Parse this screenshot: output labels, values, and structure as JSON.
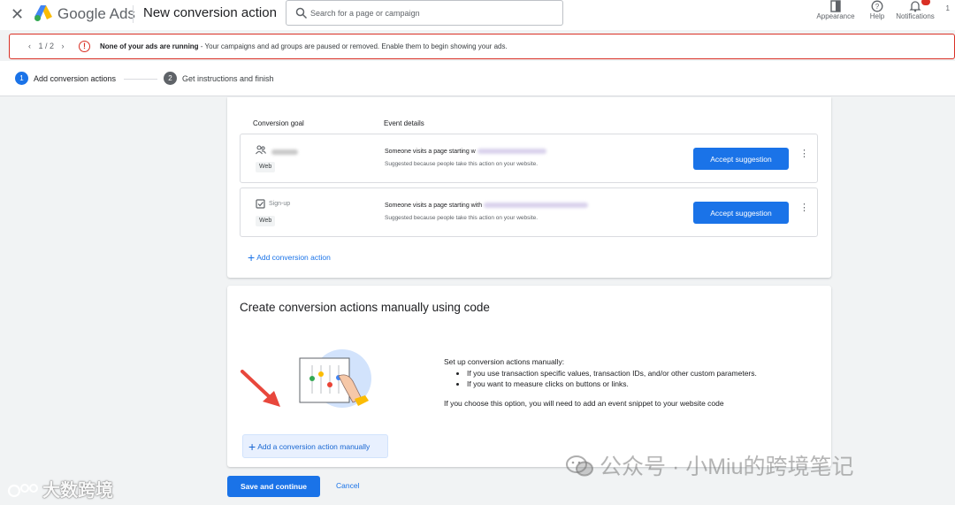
{
  "header": {
    "brand": "Google Ads",
    "title": "New conversion action",
    "search_placeholder": "Search for a page or campaign",
    "actions": [
      {
        "label": "Appearance",
        "icon": "appearance-icon"
      },
      {
        "label": "Help",
        "icon": "help-icon"
      },
      {
        "label": "Notifications",
        "icon": "bell-icon"
      }
    ],
    "edge_char": "1"
  },
  "alert": {
    "pager": "1 / 2",
    "title": "None of your ads are running",
    "message": " - Your campaigns and ad groups are paused or removed. Enable them to begin showing your ads."
  },
  "stepper": {
    "steps": [
      {
        "num": "1",
        "label": "Add conversion actions",
        "active": true
      },
      {
        "num": "2",
        "label": "Get instructions and finish",
        "active": false
      }
    ]
  },
  "suggestions": {
    "col_goal": "Conversion goal",
    "col_event": "Event details",
    "rows": [
      {
        "goal_type": "Web",
        "event_prefix": "Someone visits a page starting w",
        "event_reason": "Suggested because people take this action on your website.",
        "button": "Accept suggestion"
      },
      {
        "goal_name": "Sign-up",
        "goal_type": "Web",
        "event_prefix": "Someone visits a page starting with",
        "event_reason": "Suggested because people take this action on your website.",
        "button": "Accept suggestion"
      }
    ],
    "add_action": "Add conversion action"
  },
  "manual": {
    "title": "Create conversion actions manually using code",
    "intro": "Set up conversion actions manually:",
    "bullets": [
      "If you use transaction specific values, transaction IDs, and/or other custom parameters.",
      "If you want to measure clicks on buttons or links."
    ],
    "note": "If you choose this option, you will need to add an event snippet to your website code",
    "button": "Add a conversion action manually"
  },
  "footer": {
    "save": "Save and continue",
    "cancel": "Cancel"
  },
  "watermarks": {
    "right": "公众号 · 小Miu的跨境笔记",
    "left": "大数跨境"
  },
  "colors": {
    "primary": "#1a73e8",
    "error": "#d93025",
    "background": "#f1f3f4"
  }
}
